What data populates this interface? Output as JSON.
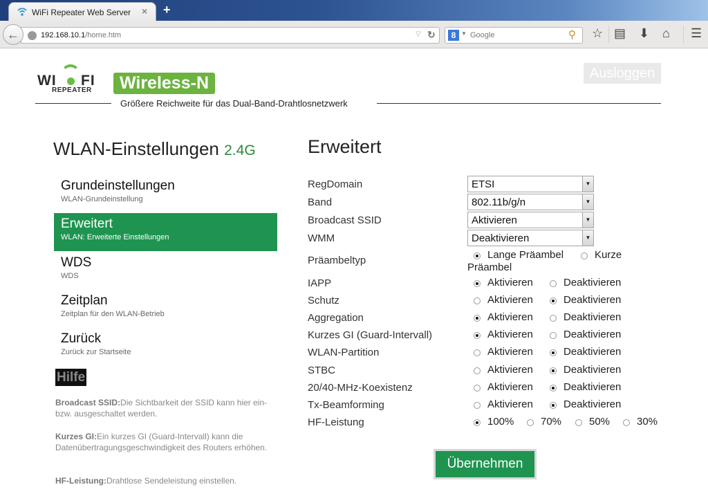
{
  "browser": {
    "tab_title": "WiFi Repeater Web Server",
    "tab_close": "×",
    "new_tab": "+",
    "url_host": "192.168.10.1",
    "url_path": "/home.htm",
    "search_engine_icon": "8",
    "search_placeholder": "Google",
    "icons": [
      "back-arrow-icon",
      "globe-icon",
      "reload-icon",
      "magnifier-icon",
      "star-icon",
      "clipboard-icon",
      "download-icon",
      "home-icon",
      "menu-icon"
    ]
  },
  "header": {
    "logo_wi": "WI",
    "logo_fi": "FI",
    "logo_repeater": "REPEATER",
    "badge": "Wireless-N",
    "logout": "Ausloggen",
    "tagline": "Größere Reichweite für das Dual-Band-Drahtlosnetzwerk"
  },
  "sidebar": {
    "title": "WLAN-Einstellungen",
    "title_band": "2.4G",
    "items": [
      {
        "label": "Grundeinstellungen",
        "sub": "WLAN-Grundeinstellung",
        "active": false
      },
      {
        "label": "Erweitert",
        "sub": "WLAN: Erweiterte Einstellungen",
        "active": true
      },
      {
        "label": "WDS",
        "sub": "WDS",
        "active": false
      },
      {
        "label": "Zeitplan",
        "sub": "Zeitplan für den WLAN-Betrieb",
        "active": false
      },
      {
        "label": "Zurück",
        "sub": "Zurück zur Startseite",
        "active": false
      }
    ],
    "help_label": "Hilfe",
    "help": [
      {
        "term": "Broadcast SSID:",
        "text": "Die Sichtbarkeit der SSID kann hier ein- bzw. ausgeschaltet werden."
      },
      {
        "term": "Kurzes GI:",
        "text": "Ein kurzes GI (Guard-Intervall) kann die Datenübertragungsgeschwindigkeit des Routers erhöhen."
      },
      {
        "term": "HF-Leistung:",
        "text": "Drahtlose Sendeleistung einstellen."
      }
    ]
  },
  "main": {
    "title": "Erweitert",
    "selects": [
      {
        "label": "RegDomain",
        "value": "ETSI"
      },
      {
        "label": "Band",
        "value": "802.11b/g/n"
      },
      {
        "label": "Broadcast SSID",
        "value": "Aktivieren"
      },
      {
        "label": "WMM",
        "value": "Deaktivieren"
      }
    ],
    "preamble": {
      "label": "Präambeltyp",
      "options": [
        "Lange Präambel",
        "Kurze Präambel"
      ],
      "selected": 0
    },
    "radios": [
      {
        "label": "IAPP",
        "options": [
          "Aktivieren",
          "Deaktivieren"
        ],
        "selected": 0
      },
      {
        "label": "Schutz",
        "options": [
          "Aktivieren",
          "Deaktivieren"
        ],
        "selected": 1
      },
      {
        "label": "Aggregation",
        "options": [
          "Aktivieren",
          "Deaktivieren"
        ],
        "selected": 0
      },
      {
        "label": "Kurzes GI (Guard-Intervall)",
        "options": [
          "Aktivieren",
          "Deaktivieren"
        ],
        "selected": 0
      },
      {
        "label": "WLAN-Partition",
        "options": [
          "Aktivieren",
          "Deaktivieren"
        ],
        "selected": 1
      },
      {
        "label": "STBC",
        "options": [
          "Aktivieren",
          "Deaktivieren"
        ],
        "selected": 1
      },
      {
        "label": "20/40-MHz-Koexistenz",
        "options": [
          "Aktivieren",
          "Deaktivieren"
        ],
        "selected": 1
      },
      {
        "label": "Tx-Beamforming",
        "options": [
          "Aktivieren",
          "Deaktivieren"
        ],
        "selected": 1
      }
    ],
    "power": {
      "label": "HF-Leistung",
      "options": [
        "100%",
        "70%",
        "50%",
        "30%"
      ],
      "selected": 0
    },
    "apply_label": "Übernehmen"
  },
  "colors": {
    "accent_green": "#1e9450",
    "logo_green": "#6cb33f"
  }
}
